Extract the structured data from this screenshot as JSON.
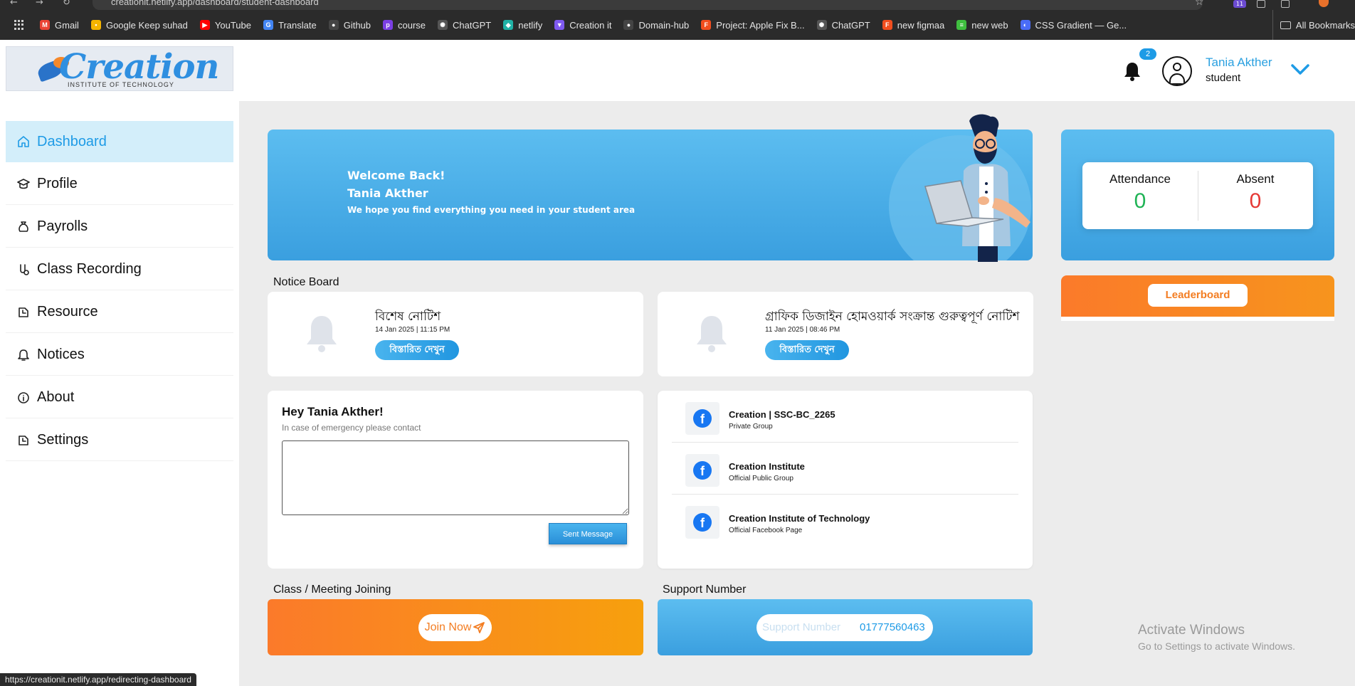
{
  "browser": {
    "url": "creationit.netlify.app/dashboard/student-dashboard",
    "status_url": "https://creationit.netlify.app/redirecting-dashboard",
    "extension_badge": "11",
    "bookmarks": [
      {
        "label": "Gmail",
        "icon": "gmail-icon",
        "color": "#ea4335",
        "glyph": "M"
      },
      {
        "label": "Google Keep suhad",
        "icon": "keep-icon",
        "color": "#f4b400",
        "glyph": "•"
      },
      {
        "label": "YouTube",
        "icon": "youtube-icon",
        "color": "#ff0000",
        "glyph": "▶"
      },
      {
        "label": "Translate",
        "icon": "translate-icon",
        "color": "#4285f4",
        "glyph": "G"
      },
      {
        "label": "Github",
        "icon": "github-icon",
        "color": "#444444",
        "glyph": "●"
      },
      {
        "label": "course",
        "icon": "course-icon",
        "color": "#7b3fe4",
        "glyph": "p"
      },
      {
        "label": "ChatGPT",
        "icon": "chatgpt-icon",
        "color": "#555555",
        "glyph": "✺"
      },
      {
        "label": "netlify",
        "icon": "netlify-icon",
        "color": "#20b2a6",
        "glyph": "◆"
      },
      {
        "label": "Creation it",
        "icon": "creation-icon",
        "color": "#7f5af0",
        "glyph": "▼"
      },
      {
        "label": "Domain-hub",
        "icon": "github-icon",
        "color": "#444444",
        "glyph": "●"
      },
      {
        "label": "Project: Apple Fix B...",
        "icon": "figma-icon",
        "color": "#f24e1e",
        "glyph": "F"
      },
      {
        "label": "ChatGPT",
        "icon": "chatgpt-icon",
        "color": "#555555",
        "glyph": "✺"
      },
      {
        "label": "new figmaa",
        "icon": "figma-icon",
        "color": "#f24e1e",
        "glyph": "F"
      },
      {
        "label": "new web",
        "icon": "web-icon",
        "color": "#3fbf3f",
        "glyph": "≡"
      },
      {
        "label": "CSS Gradient — Ge...",
        "icon": "gradient-icon",
        "color": "#4a6cf7",
        "glyph": "◐"
      }
    ],
    "all_bookmarks": "All Bookmarks"
  },
  "header": {
    "logo_text": "Creation",
    "logo_subtitle": "INSTITUTE OF TECHNOLOGY",
    "notification_count": "2",
    "user_name": "Tania Akther",
    "user_role": "student"
  },
  "sidebar": {
    "items": [
      {
        "label": "Dashboard",
        "icon": "home-icon",
        "active": true
      },
      {
        "label": "Profile",
        "icon": "graduation-cap-icon"
      },
      {
        "label": "Payrolls",
        "icon": "money-bag-icon"
      },
      {
        "label": "Class Recording",
        "icon": "recording-icon"
      },
      {
        "label": "Resource",
        "icon": "resource-icon"
      },
      {
        "label": "Notices",
        "icon": "bell-icon"
      },
      {
        "label": "About",
        "icon": "info-icon"
      },
      {
        "label": "Settings",
        "icon": "settings-icon"
      }
    ]
  },
  "welcome": {
    "line1": "Welcome Back!",
    "line2": "Tania Akther",
    "line3": "We hope you find everything you need in your student area"
  },
  "stats": {
    "attendance_label": "Attendance",
    "attendance_value": "0",
    "absent_label": "Absent",
    "absent_value": "0",
    "attendance_color": "#1fb355",
    "absent_color": "#e53935"
  },
  "leaderboard": {
    "label": "Leaderboard"
  },
  "notice_board": {
    "title": "Notice Board",
    "notices": [
      {
        "title": "বিশেষ নোটিশ",
        "date": "14 Jan 2025 | 11:15 PM",
        "button": "বিস্তারিত দেখুন"
      },
      {
        "title": "গ্রাফিক ডিজাইন হোমওয়ার্ক সংক্রান্ত গুরুত্বপূর্ণ নোটিশ",
        "date": "11 Jan 2025 | 08:46 PM",
        "button": "বিস্তারিত দেখুন"
      }
    ]
  },
  "contact": {
    "greeting": "Hey Tania Akther!",
    "subtitle": "In case of emergency please contact",
    "message_value": "",
    "send_label": "Sent Message"
  },
  "social": [
    {
      "title": "Creation | SSC-BC_2265",
      "subtitle": "Private Group",
      "icon": "facebook-icon"
    },
    {
      "title": "Creation Institute",
      "subtitle": "Official Public Group",
      "icon": "facebook-icon"
    },
    {
      "title": "Creation Institute of Technology",
      "subtitle": "Official Facebook Page",
      "icon": "facebook-icon"
    }
  ],
  "class_meeting": {
    "title": "Class / Meeting Joining",
    "button": "Join Now"
  },
  "support": {
    "title": "Support Number",
    "placeholder": "Support Number",
    "number": "01777560463"
  },
  "windows": {
    "line1": "Activate Windows",
    "line2": "Go to Settings to activate Windows."
  },
  "colors": {
    "accent_blue": "#1e9be6",
    "accent_orange": "#f37d22"
  }
}
